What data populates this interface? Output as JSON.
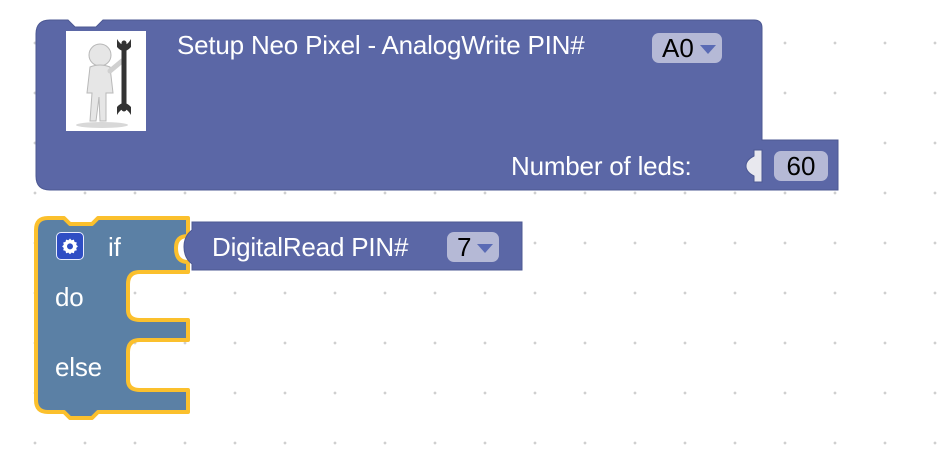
{
  "workspace": {
    "colors": {
      "background": "#ffffff",
      "grid_dot": "#cfcfcf"
    }
  },
  "setup_block": {
    "title": "Setup Neo Pixel - AnalogWrite PIN#",
    "pin_value": "A0",
    "leds_label": "Number of leds:",
    "leds_value": "60",
    "image_icon": "mechanic-figure-with-wrench-icon",
    "colors": {
      "block": "#5b67a6",
      "field": "#b5b9d6"
    }
  },
  "if_block": {
    "if_label": "if",
    "do_label": "do",
    "else_label": "else",
    "mutator_icon": "gear-icon",
    "colors": {
      "block": "#5b80a5",
      "highlight": "#fbc02d"
    }
  },
  "digital_read_block": {
    "label": "DigitalRead PIN#",
    "pin_value": "7",
    "colors": {
      "block": "#5b67a6"
    }
  }
}
